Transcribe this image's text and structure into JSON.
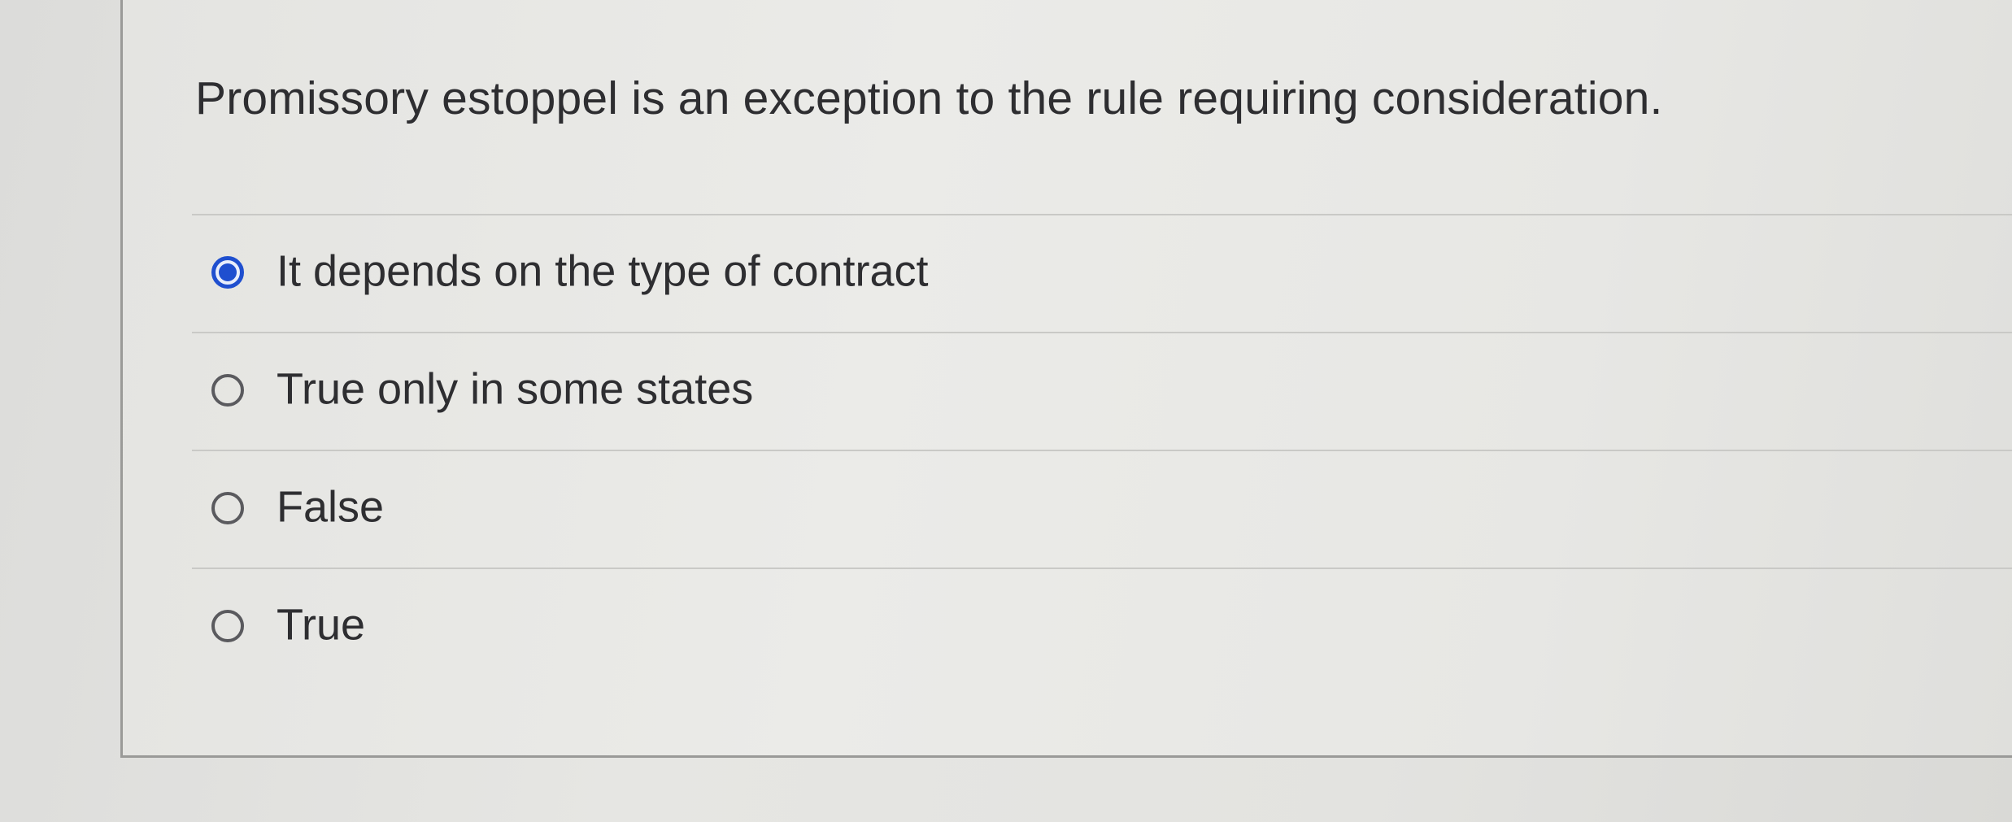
{
  "question": {
    "text": "Promissory estoppel is an exception to the rule requiring consideration."
  },
  "options": [
    {
      "label": "It depends on the type of contract",
      "selected": true
    },
    {
      "label": "True only in some states",
      "selected": false
    },
    {
      "label": "False",
      "selected": false
    },
    {
      "label": "True",
      "selected": false
    }
  ],
  "colors": {
    "selected_radio": "#1f4fcf",
    "text": "#2e2e31"
  }
}
